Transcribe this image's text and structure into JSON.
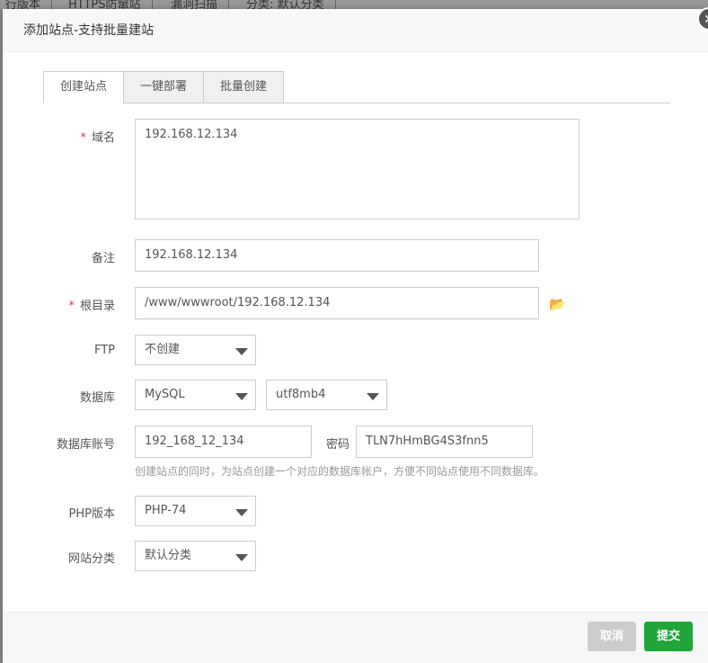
{
  "background": {
    "toolbar": [
      "行版本",
      "HTTPS防窜站",
      "漏洞扫描",
      "分类: 默认分类"
    ]
  },
  "dialog": {
    "title": "添加站点-支持批量建站",
    "close_icon": "close-icon"
  },
  "tabs": [
    {
      "label": "创建站点",
      "active": true
    },
    {
      "label": "一键部署"
    },
    {
      "label": "批量创建"
    }
  ],
  "form": {
    "domain": {
      "label": "域名",
      "required": "*",
      "value": "192.168.12.134"
    },
    "remark": {
      "label": "备注",
      "value": "192.168.12.134"
    },
    "root": {
      "label": "根目录",
      "required": "*",
      "value": "/www/wwwroot/192.168.12.134",
      "icon": "folder-open-icon"
    },
    "ftp": {
      "label": "FTP",
      "value": "不创建"
    },
    "database": {
      "label": "数据库",
      "type": "MySQL",
      "charset": "utf8mb4"
    },
    "db_account": {
      "label": "数据库账号",
      "value": "192_168_12_134",
      "password_label": "密码",
      "password": "TLN7hHmBG4S3fnn5",
      "hint": "创建站点的同时，为站点创建一个对应的数据库帐户，方便不同站点使用不同数据库。"
    },
    "php": {
      "label": "PHP版本",
      "value": "PHP-74"
    },
    "category": {
      "label": "网站分类",
      "value": "默认分类"
    }
  },
  "footer": {
    "cancel": "取消",
    "submit": "提交",
    "cancel_color": "#cccccc",
    "submit_color": "#20a53a"
  }
}
